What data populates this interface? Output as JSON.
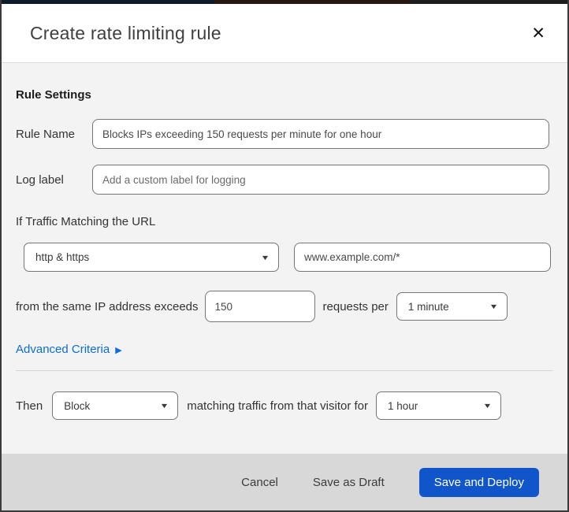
{
  "modal": {
    "title": "Create rate limiting rule"
  },
  "icons": {
    "close": "✕",
    "caret_down": "▼",
    "arrow_right": "▶"
  },
  "rule_settings": {
    "heading": "Rule Settings",
    "rule_name_label": "Rule Name",
    "rule_name_value": "Blocks IPs exceeding 150 requests per minute for one hour",
    "log_label_label": "Log label",
    "log_label_placeholder": "Add a custom label for logging"
  },
  "criteria": {
    "intro": "If Traffic Matching the URL",
    "scheme_selected": "http & https",
    "url_value": "www.example.com/*",
    "exceeds_text": "from the same IP address exceeds",
    "threshold_value": "150",
    "requests_per_text": "requests per",
    "period_selected": "1 minute",
    "advanced_link": "Advanced Criteria"
  },
  "action": {
    "then_label": "Then",
    "action_selected": "Block",
    "matching_text": "matching traffic from that visitor for",
    "duration_selected": "1 hour"
  },
  "footer": {
    "cancel_label": "Cancel",
    "save_draft_label": "Save as Draft",
    "save_deploy_label": "Save and Deploy"
  },
  "colors": {
    "link_blue": "#0d6ed3",
    "primary_button_blue": "#1155cb",
    "body_background": "#f3f3f3",
    "footer_background": "#d8d8d8"
  }
}
